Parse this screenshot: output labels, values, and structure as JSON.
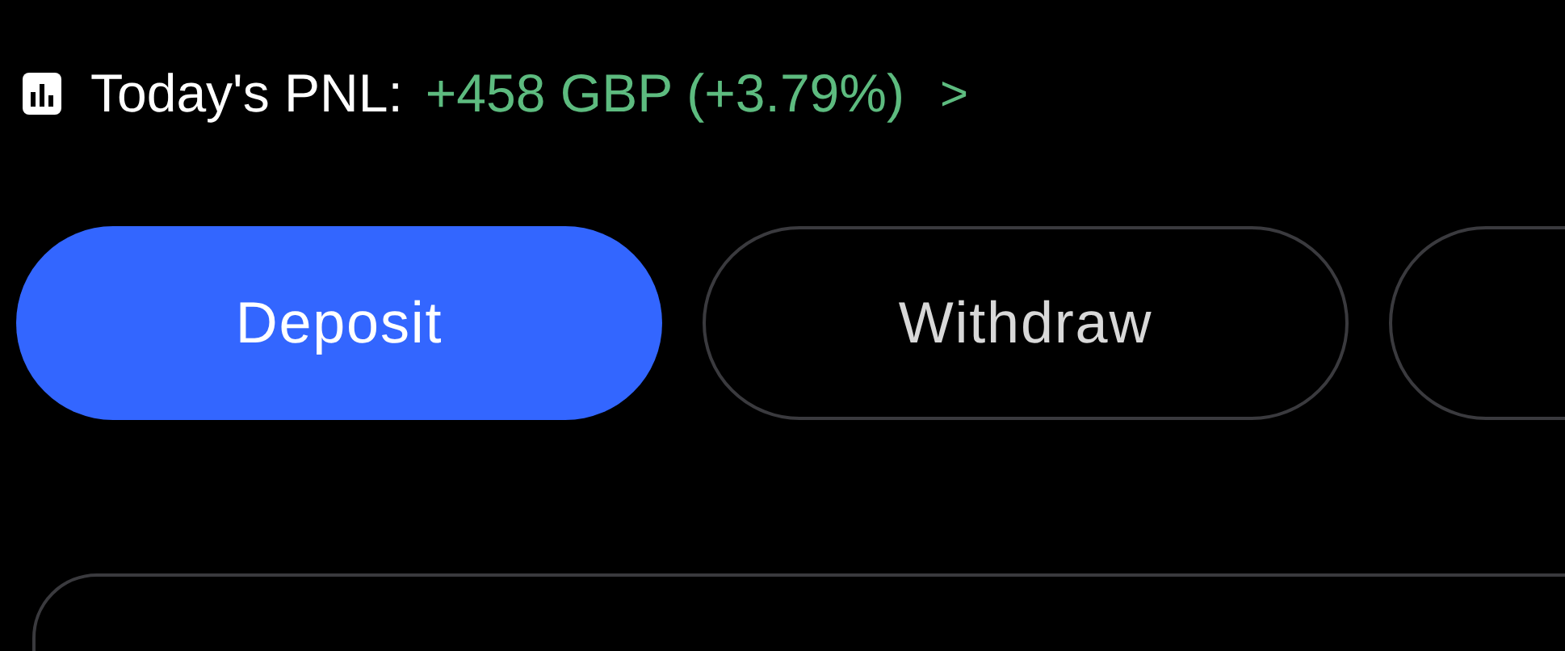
{
  "pnl": {
    "label": "Today's PNL:",
    "value": "+458 GBP (+3.79%)",
    "chevron": ">"
  },
  "buttons": [
    {
      "label": "Deposit",
      "kind": "primary"
    },
    {
      "label": "Withdraw",
      "kind": "outline"
    },
    {
      "kind": "outline"
    }
  ]
}
